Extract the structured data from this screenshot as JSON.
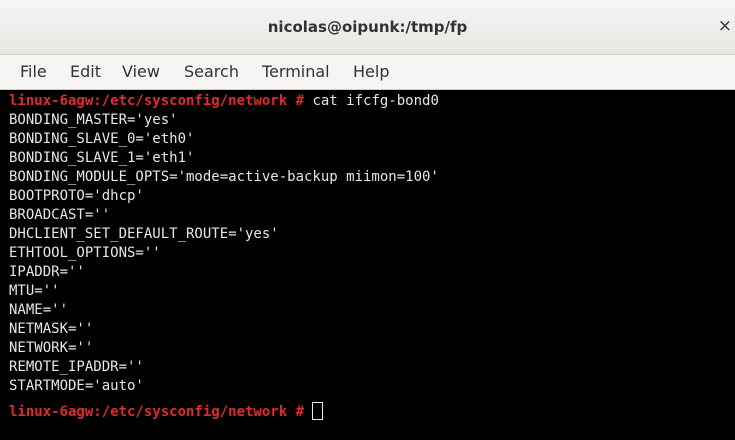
{
  "window": {
    "title": "nicolas@oipunk:/tmp/fp",
    "close_glyph": "×"
  },
  "menu": {
    "items": [
      "File",
      "Edit",
      "View",
      "Search",
      "Terminal",
      "Help"
    ]
  },
  "terminal": {
    "prompt": "linux-6agw:/etc/sysconfig/network #",
    "command": " cat ifcfg-bond0",
    "output": [
      "BONDING_MASTER='yes'",
      "BONDING_SLAVE_0='eth0'",
      "BONDING_SLAVE_1='eth1'",
      "BONDING_MODULE_OPTS='mode=active-backup miimon=100'",
      "BOOTPROTO='dhcp'",
      "BROADCAST=''",
      "DHCLIENT_SET_DEFAULT_ROUTE='yes'",
      "ETHTOOL_OPTIONS=''",
      "IPADDR=''",
      "MTU=''",
      "NAME=''",
      "NETMASK=''",
      "NETWORK=''",
      "REMOTE_IPADDR=''",
      "STARTMODE='auto'"
    ],
    "final_prompt": "linux-6agw:/etc/sysconfig/network #"
  },
  "colors": {
    "prompt": "#e02b2b",
    "text": "#e6e6e6",
    "background": "#000000"
  }
}
